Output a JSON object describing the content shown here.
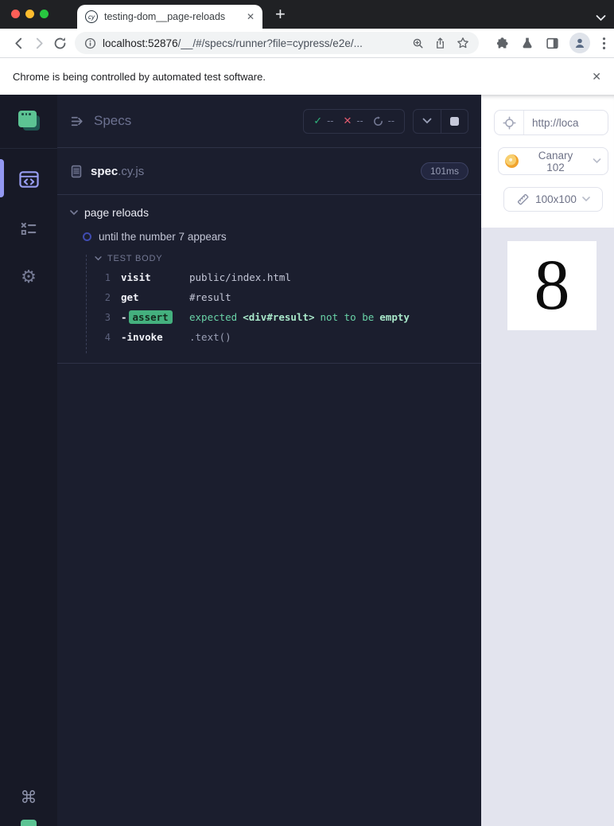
{
  "colors": {
    "accent_indigo": "#9398f2",
    "pass_green": "#2fb47c",
    "fail_red": "#e25a6e",
    "assert_badge_bg": "#44b07e",
    "assert_text_green": "#69d3a7",
    "canary_orange": "#f0a32e",
    "reporter_bg": "#1b1e2e",
    "sidebar_bg": "#171926",
    "traffic_red": "#ff5f57",
    "traffic_yellow": "#febc2e",
    "traffic_green": "#28c840"
  },
  "chrome": {
    "tab_favicon_text": "cy",
    "tab_title": "testing-dom__page-reloads",
    "tab_close_glyph": "✕",
    "new_tab_glyph": "+",
    "url_host": "localhost:52876",
    "url_path": "/__/#/specs/runner?file=cypress/e2e/...",
    "banner_text": "Chrome is being controlled by automated test software.",
    "banner_close_glyph": "✕"
  },
  "sidebar": {
    "gear_glyph": "⚙",
    "command_glyph": "⌘"
  },
  "reporter": {
    "title": "Specs",
    "stats": {
      "passed": "--",
      "failed": "--",
      "pending": "--",
      "passed_glyph": "✓",
      "failed_glyph": "✕"
    },
    "spec_name": "spec",
    "spec_ext": ".cy.js",
    "spec_duration": "101ms",
    "suite_title": "page reloads",
    "test_title": "until the number 7 appears",
    "body_label": "TEST BODY",
    "commands": [
      {
        "n": "1",
        "dash": "",
        "name": "visit",
        "args": "public/index.html"
      },
      {
        "n": "2",
        "dash": "",
        "name": "get",
        "args": "#result"
      },
      {
        "n": "3",
        "dash": "-",
        "name": "assert",
        "msg_1": "expected",
        "msg_2": "<div#result>",
        "msg_3": "not to be",
        "msg_4": "empty"
      },
      {
        "n": "4",
        "dash": "-",
        "name": "invoke",
        "args": ".text()"
      }
    ]
  },
  "preview": {
    "url_display": "http://loca",
    "browser_name": "Canary",
    "browser_version": "102",
    "viewport_size": "100x100",
    "aut_value": "8"
  }
}
